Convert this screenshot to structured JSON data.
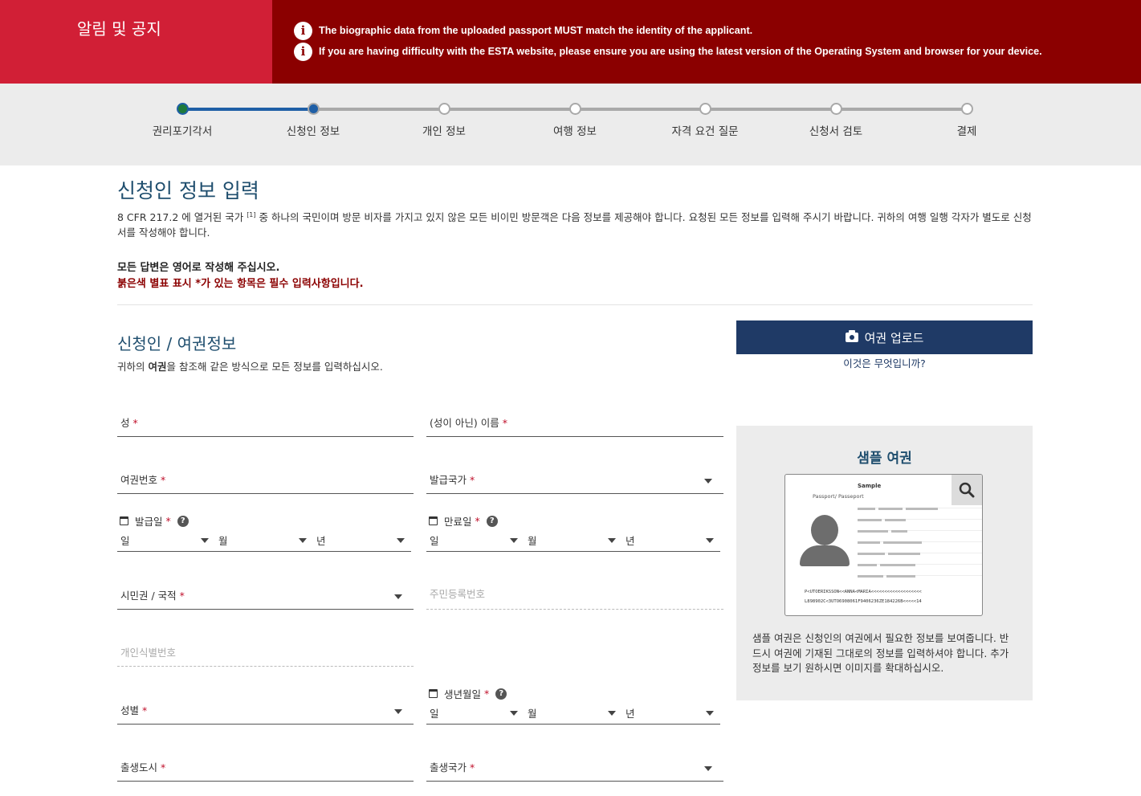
{
  "alert": {
    "title": "알림 및 공지",
    "messages": [
      "The biographic data from the uploaded passport MUST match the identity of the applicant.",
      "If you are having difficulty with the ESTA website, please ensure you are using the latest version of the Operating System and browser for your device."
    ]
  },
  "stepper": {
    "steps": [
      "권리포기각서",
      "신청인 정보",
      "개인 정보",
      "여행 정보",
      "자격 요건 질문",
      "신청서 검토",
      "결제"
    ],
    "current_step": 2
  },
  "page": {
    "title": "신청인 정보 입력",
    "intro_before": "8 CFR 217.2 에 열거된 국가 ",
    "intro_sup": "[1]",
    "intro_after": " 중 하나의 국민이며 방문 비자를 가지고 있지 않은 모든 비이민 방문객은 다음 정보를 제공해야 합니다. 요청된 모든 정보를 입력해 주시기 바랍니다. 귀하의 여행 일행 각자가 별도로 신청서를 작성해야 합니다.",
    "note_english": "모든 답변은 영어로 작성해 주십시오.",
    "note_required": "붉은색 별표 표시 *가 있는 항목은 필수 입력사항입니다."
  },
  "section": {
    "title": "신청인 / 여권정보",
    "sub_before": "귀하의 ",
    "sub_bold": "여권",
    "sub_after": "을 참조해 같은 방식으로 모든 정보를 입력하십시오."
  },
  "upload": {
    "button_label": "여권 업로드",
    "help_link": "이것은 무엇입니까?"
  },
  "sample": {
    "title": "샘플 여권",
    "passport_sample_word": "Sample",
    "passport_word": "Passport/ Passeport",
    "mrz_line1": "P<UTOERIKSSON<<ANNA<MARIA<<<<<<<<<<<<<<<<<<<",
    "mrz_line2": "L898902C<3UTO6908061F9406236ZE184226B<<<<<14",
    "description": "샘플 여권은 신청인의 여권에서 필요한 정보를 보여줍니다. 반드시 여권에 기재된 그대로의 정보를 입력하셔야 합니다. 추가 정보를 보기 원하시면 이미지를 확대하십시오."
  },
  "form": {
    "surname": "성",
    "given_name": "(성이 아닌) 이름",
    "passport_number": "여권번호",
    "issuing_country": "발급국가",
    "issue_date": "발급일",
    "expiry_date": "만료일",
    "day": "일",
    "month": "월",
    "year": "년",
    "citizenship": "시민권 / 국적",
    "national_id": "주민등록번호",
    "personal_id": "개인식별번호",
    "birth_date": "생년월일",
    "gender": "성별",
    "birth_city": "출생도시",
    "birth_country": "출생국가",
    "required_mark": "*",
    "help_mark": "?"
  },
  "colors": {
    "alert_bg": "#8b0000",
    "alert_title_bg": "#d11f36",
    "primary_button": "#1f3a66",
    "heading": "#1f4e6e",
    "required": "#c0102b"
  }
}
